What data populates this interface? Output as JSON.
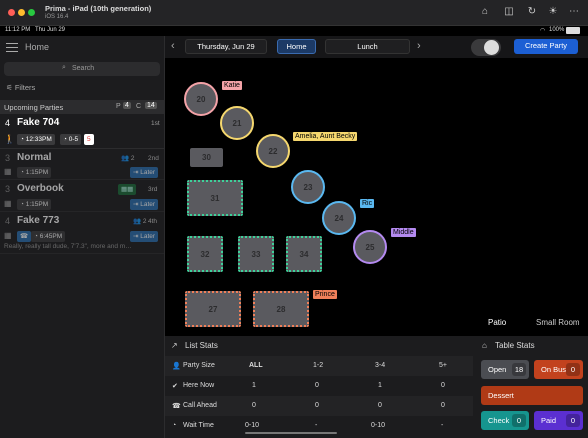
{
  "window": {
    "title": "Prima - iPad (10th generation)",
    "subtitle": "iOS 16.4"
  },
  "status": {
    "time": "11:12 PM",
    "date": "Thu Jun 29",
    "battery": "100%"
  },
  "sidebar": {
    "home_label": "Home",
    "search_placeholder": "Search",
    "filters_label": "Filters",
    "section_title": "Upcoming Parties",
    "p_label": "P",
    "p_count": "4",
    "c_label": "C",
    "c_count": "14",
    "parties": [
      {
        "num": "4",
        "name": "Fake 704",
        "badge": "1st",
        "time": "12:33PM",
        "size": "0-5",
        "extra": "5"
      },
      {
        "num": "3",
        "name": "Normal",
        "count": "2",
        "badge": "2nd",
        "time": "1:15PM",
        "action": "Later"
      },
      {
        "num": "3",
        "name": "Overbook",
        "badge": "3rd",
        "time": "1:15PM",
        "action": "Later"
      },
      {
        "num": "4",
        "name": "Fake 773",
        "count": "2",
        "badge": "4th",
        "time": "6:45PM",
        "action": "Later",
        "note": "Really, really tall dude, 7'7.3\", more and m…"
      }
    ]
  },
  "nav": {
    "date": "Thursday, Jun 29",
    "home": "Home",
    "meal": "Lunch",
    "create": "Create Party"
  },
  "floor": {
    "round_tables": [
      {
        "id": "20",
        "color": "#f4a3a8"
      },
      {
        "id": "21",
        "color": "#f5d76e"
      },
      {
        "id": "22",
        "color": "#f5d76e"
      },
      {
        "id": "23",
        "color": "#5ab8f0"
      },
      {
        "id": "24",
        "color": "#5ab8f0"
      },
      {
        "id": "25",
        "color": "#b48af0"
      }
    ],
    "square_tables": [
      {
        "id": "30",
        "color": "none"
      },
      {
        "id": "31",
        "color": "#3ed19a"
      },
      {
        "id": "32",
        "color": "#3ed19a"
      },
      {
        "id": "33",
        "color": "#3ed19a"
      },
      {
        "id": "34",
        "color": "#3ed19a"
      },
      {
        "id": "27",
        "color": "#f0805a"
      },
      {
        "id": "28",
        "color": "#f0805a"
      }
    ],
    "tags": [
      {
        "text": "Katie",
        "color": "#f4a3a8"
      },
      {
        "text": "Amelia, Aunt Becky",
        "color": "#f5d76e"
      },
      {
        "text": "Ric",
        "color": "#5ab8f0"
      },
      {
        "text": "Middle",
        "color": "#b48af0"
      },
      {
        "text": "Prince",
        "color": "#f0805a"
      }
    ],
    "rooms": [
      "Patio",
      "Small Room"
    ]
  },
  "list_stats": {
    "title": "List Stats",
    "columns": [
      "ALL",
      "1-2",
      "3-4",
      "5+"
    ],
    "rows": [
      {
        "label": "Party Size",
        "values": [
          "ALL",
          "1-2",
          "3-4",
          "5+"
        ]
      },
      {
        "label": "Here Now",
        "values": [
          "1",
          "0",
          "1",
          "0"
        ]
      },
      {
        "label": "Call Ahead",
        "values": [
          "0",
          "0",
          "0",
          "0"
        ]
      },
      {
        "label": "Wait Time",
        "values": [
          "0-10",
          "-",
          "0-10",
          "-"
        ]
      }
    ]
  },
  "table_stats": {
    "title": "Table Stats",
    "open": {
      "label": "Open",
      "value": "18"
    },
    "onbus": {
      "label": "On Bus",
      "value": "0"
    },
    "dessert": {
      "label": "Dessert"
    },
    "check": {
      "label": "Check",
      "value": "0"
    },
    "paid": {
      "label": "Paid",
      "value": "0"
    }
  }
}
